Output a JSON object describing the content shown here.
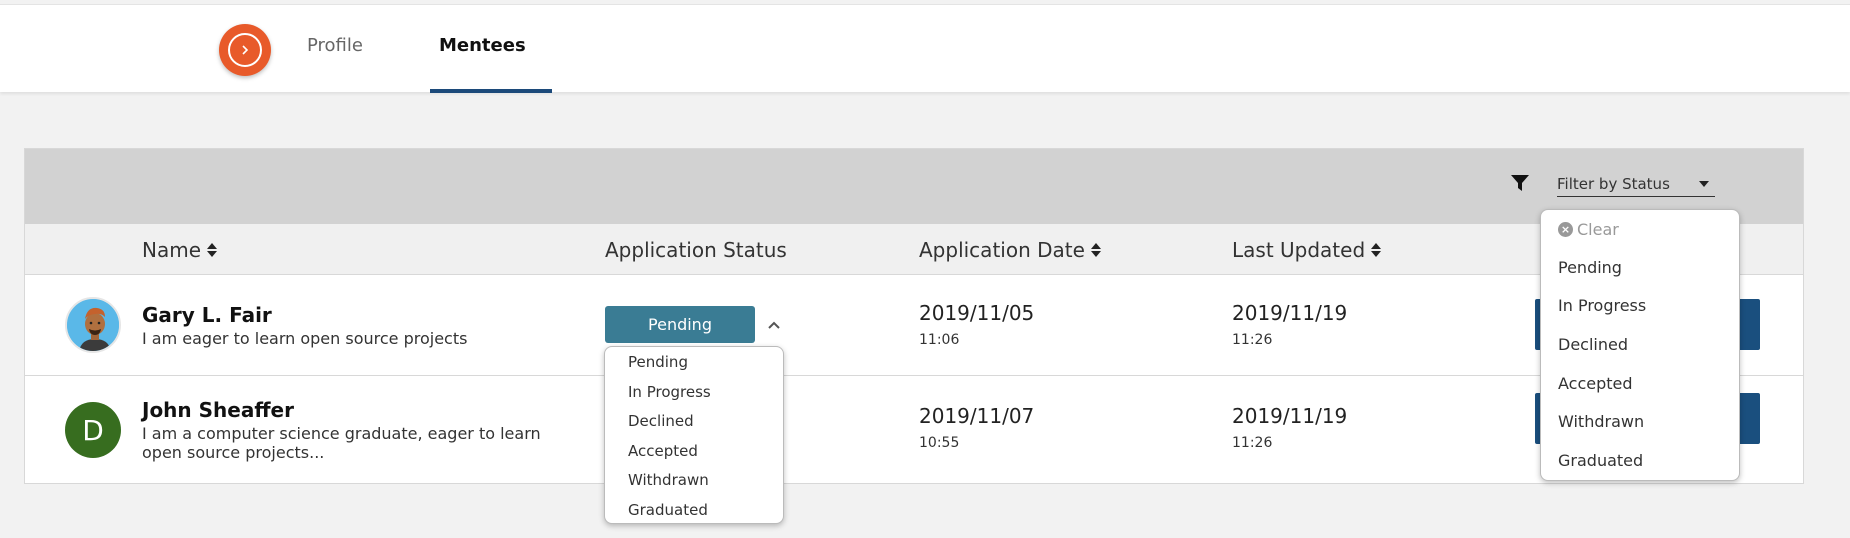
{
  "nav": {
    "toggle_icon": "chevron-right-icon",
    "tabs": [
      {
        "label": "Profile",
        "active": false
      },
      {
        "label": "Mentees",
        "active": true
      }
    ],
    "accent_color": "#e85a2a",
    "underline_color": "#1c4a7a"
  },
  "filter": {
    "icon": "filter-icon",
    "label": "Filter by Status",
    "options": {
      "clear": "Clear",
      "items": [
        "Pending",
        "In Progress",
        "Declined",
        "Accepted",
        "Withdrawn",
        "Graduated"
      ]
    }
  },
  "table": {
    "headers": {
      "name": "Name",
      "status": "Application Status",
      "app_date": "Application Date",
      "last_updated": "Last Updated"
    },
    "rows": [
      {
        "avatar": "illustrated-avatar",
        "name": "Gary L. Fair",
        "desc": "I am eager to learn open source projects",
        "status": "Pending",
        "app_date": "2019/11/05",
        "app_time": "11:06",
        "updated_date": "2019/11/19",
        "updated_time": "11:26"
      },
      {
        "avatar_letter": "D",
        "name": "John Sheaffer",
        "desc": "I am a computer science graduate, eager to learn open source projects...",
        "app_date": "2019/11/07",
        "app_time": "10:55",
        "updated_date": "2019/11/19",
        "updated_time": "11:26"
      }
    ]
  },
  "status_dropdown": {
    "options": [
      "Pending",
      "In Progress",
      "Declined",
      "Accepted",
      "Withdrawn",
      "Graduated"
    ]
  },
  "colors": {
    "status_button": "#3a7c94",
    "action_button": "#1a4f7e",
    "letter_avatar": "#376d1f"
  }
}
